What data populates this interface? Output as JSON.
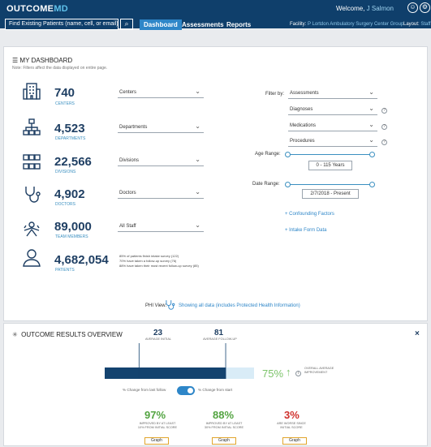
{
  "app": {
    "logo_part1": "OUTCOME",
    "logo_part2": "MD"
  },
  "header": {
    "welcome_prefix": "Welcome,",
    "user": "J Salmon",
    "search_placeholder": "Find Existing Patients (name, cell, or email)",
    "tabs": [
      "Dashboard",
      "Assessments",
      "Reports"
    ],
    "facility_label": "Facility:",
    "facility_value": "P Lortdon Ambulatory Surgery Center Group",
    "layout_label": "Layout:",
    "layout_value": "Staff"
  },
  "dashboard": {
    "title": "MY DASHBOARD",
    "subtitle": "Note: Filters affect the data displayed on entire page.",
    "stats": [
      {
        "value": "740",
        "label": "CENTERS",
        "filter": "Centers"
      },
      {
        "value": "4,523",
        "label": "DEPARTMENTS",
        "filter": "Departments"
      },
      {
        "value": "22,566",
        "label": "DIVISIONS",
        "filter": "Divisions"
      },
      {
        "value": "4,902",
        "label": "DOCTORS",
        "filter": "Doctors"
      },
      {
        "value": "89,000",
        "label": "TEAM MEMBERS",
        "filter": "All Staff"
      },
      {
        "value": "4,682,054",
        "label": "PATIENTS"
      }
    ],
    "patient_notes": [
      "85% of patients finish intake survey (122)",
      "70% have taken a follow-up survey (76)",
      "88% have taken their most recent follow-up survey (85)"
    ],
    "filter_by_label": "Filter by:",
    "filter_selects": [
      "Assessments",
      "Diagnoses",
      "Medications",
      "Procedures"
    ],
    "age_range_label": "Age Range:",
    "age_range_value": "0 - 115 Years",
    "date_range_label": "Date Range:",
    "date_range_value": "2/7/2018 - Present",
    "link_confounding": "+ Confounding Factors",
    "link_intake": "+ Intake Form Data",
    "phi_label": "PHI View:",
    "phi_text": "Showing all data (includes Protected Health Information)"
  },
  "results": {
    "title": "OUTCOME RESULTS OVERVIEW",
    "avg_initial_value": "23",
    "avg_initial_label": "AVERAGE INITIAL",
    "avg_followup_value": "81",
    "avg_followup_label": "AVERAGE FOLLOW-UP",
    "improvement_pct": "75%",
    "improvement_label": "OVERALL AVERAGE IMPROVEMENT",
    "toggle_left": "% Change from last follow",
    "toggle_right": "% Change from start",
    "summary": [
      {
        "pct": "97%",
        "caption": "IMPROVED BY AT LEAST 10% FROM INITIAL SCORE",
        "button": "Graph"
      },
      {
        "pct": "88%",
        "caption": "IMPROVED BY AT LEAST 30% FROM INITIAL SCORE",
        "button": "Graph"
      },
      {
        "pct": "3%",
        "caption": "ARE WORSE SINCE INITIAL SCORE",
        "button": "Graph"
      }
    ]
  },
  "chart_data": {
    "type": "bar",
    "categories": [
      "AVERAGE INITIAL",
      "AVERAGE FOLLOW-UP"
    ],
    "values": [
      23,
      81
    ],
    "xlim": [
      0,
      100
    ]
  },
  "colors": {
    "nav": "#0f3f6b",
    "accent": "#2e86c8",
    "bar": "#14436f",
    "green": "#53a441",
    "red": "#d0312d",
    "button_border": "#e1a52b"
  },
  "icons": [
    "building-icon",
    "org-chart-icon",
    "divisions-icon",
    "stethoscope-icon",
    "team-icon",
    "person-icon",
    "settings-gear-icon",
    "user-circle-icon"
  ]
}
